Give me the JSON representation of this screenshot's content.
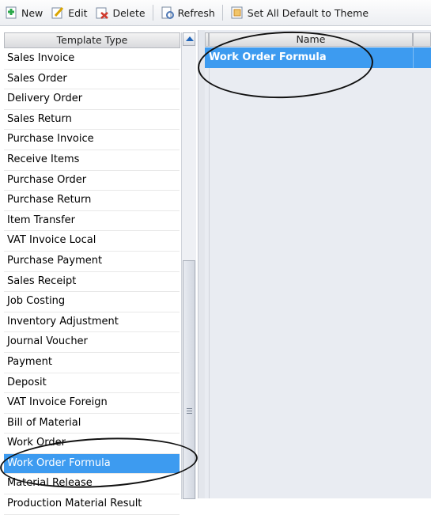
{
  "toolbar": {
    "buttons": [
      {
        "label": "New",
        "icon": "new-icon",
        "color": "#2aa84a"
      },
      {
        "label": "Edit",
        "icon": "edit-icon",
        "color": "#d9a400"
      },
      {
        "label": "Delete",
        "icon": "delete-icon",
        "color": "#d03a2e"
      },
      {
        "label": "Refresh",
        "icon": "refresh-icon",
        "color": "#4e78b5"
      },
      {
        "label": "Set All Default to Theme",
        "icon": "set-default-theme-icon",
        "color": "#c98a2a"
      }
    ]
  },
  "left_grid": {
    "header": "Template Type",
    "rows": [
      "Sales Invoice",
      "Sales Order",
      "Delivery Order",
      "Sales Return",
      "Purchase Invoice",
      "Receive Items",
      "Purchase Order",
      "Purchase Return",
      "Item Transfer",
      "VAT Invoice Local",
      "Purchase Payment",
      "Sales Receipt",
      "Job Costing",
      "Inventory Adjustment",
      "Journal Voucher",
      "Payment",
      "Deposit",
      "VAT Invoice Foreign",
      "Bill of Material",
      "Work Order",
      "Work Order Formula",
      "Material Release",
      "Production Material Result"
    ],
    "selected_row": "Work Order Formula"
  },
  "right_grid": {
    "header": "Name",
    "rows": [
      "Work Order Formula"
    ],
    "selected_row": "Work Order Formula"
  },
  "colors": {
    "selection": "#3d9bf0",
    "right_background": "#e9ecf2"
  }
}
